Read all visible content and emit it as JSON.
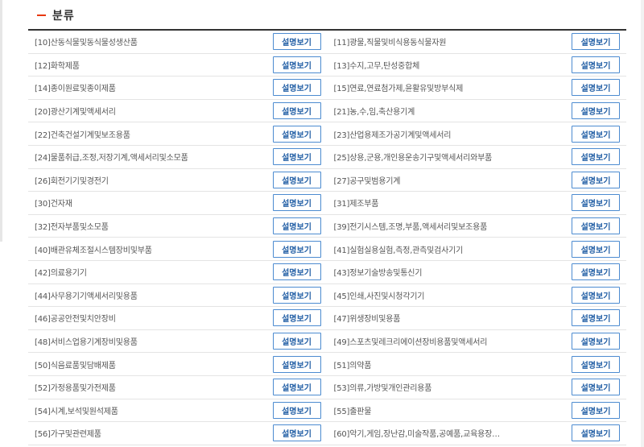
{
  "section": {
    "title": "분류"
  },
  "button_label": "설명보기",
  "rows": [
    {
      "left": "[10]산동식물및동식물성생산품",
      "right": "[11]광물,직물및비식용동식물자원"
    },
    {
      "left": "[12]화학제품",
      "right": "[13]수지,고무,탄성중합체"
    },
    {
      "left": "[14]종이원료및종이제품",
      "right": "[15]연료,연료첨가제,윤활유및방부식제"
    },
    {
      "left": "[20]광산기계및액세서리",
      "right": "[21]농,수,임,축산용기계"
    },
    {
      "left": "[22]건축건설기계및보조용품",
      "right": "[23]산업용제조가공기계및액세서리"
    },
    {
      "left": "[24]물품취급,조정,저장기계,액세서리및소모품",
      "right": "[25]상용,군용,개인용운송기구및액세서리와부품"
    },
    {
      "left": "[26]회전기기및경전기",
      "right": "[27]공구및범용기계"
    },
    {
      "left": "[30]건자재",
      "right": "[31]제조부품"
    },
    {
      "left": "[32]전자부품및소모품",
      "right": "[39]전기시스템,조명,부품,액세서리및보조용품"
    },
    {
      "left": "[40]배관유체조절시스템장비및부품",
      "right": "[41]실험실용실험,측정,관측및검사기기"
    },
    {
      "left": "[42]의료용기기",
      "right": "[43]정보기술방송및통신기"
    },
    {
      "left": "[44]사무용기기액세서리및용품",
      "right": "[45]인쇄,사진및시청각기기"
    },
    {
      "left": "[46]공공안전및치안장비",
      "right": "[47]위생장비및용품"
    },
    {
      "left": "[48]서비스업용기계장비및용품",
      "right": "[49]스포츠및레크리에이션장비용품및액세서리"
    },
    {
      "left": "[50]식음료품및담배제품",
      "right": "[51]의약품"
    },
    {
      "left": "[52]가정용품및가전제품",
      "right": "[53]의류,가방및개인관리용품"
    },
    {
      "left": "[54]시계,보석및원석제품",
      "right": "[55]출판물"
    },
    {
      "left": "[56]가구및관련제품",
      "right": "[60]악기,게임,장난감,미술작품,공예품,교육용장…"
    }
  ]
}
